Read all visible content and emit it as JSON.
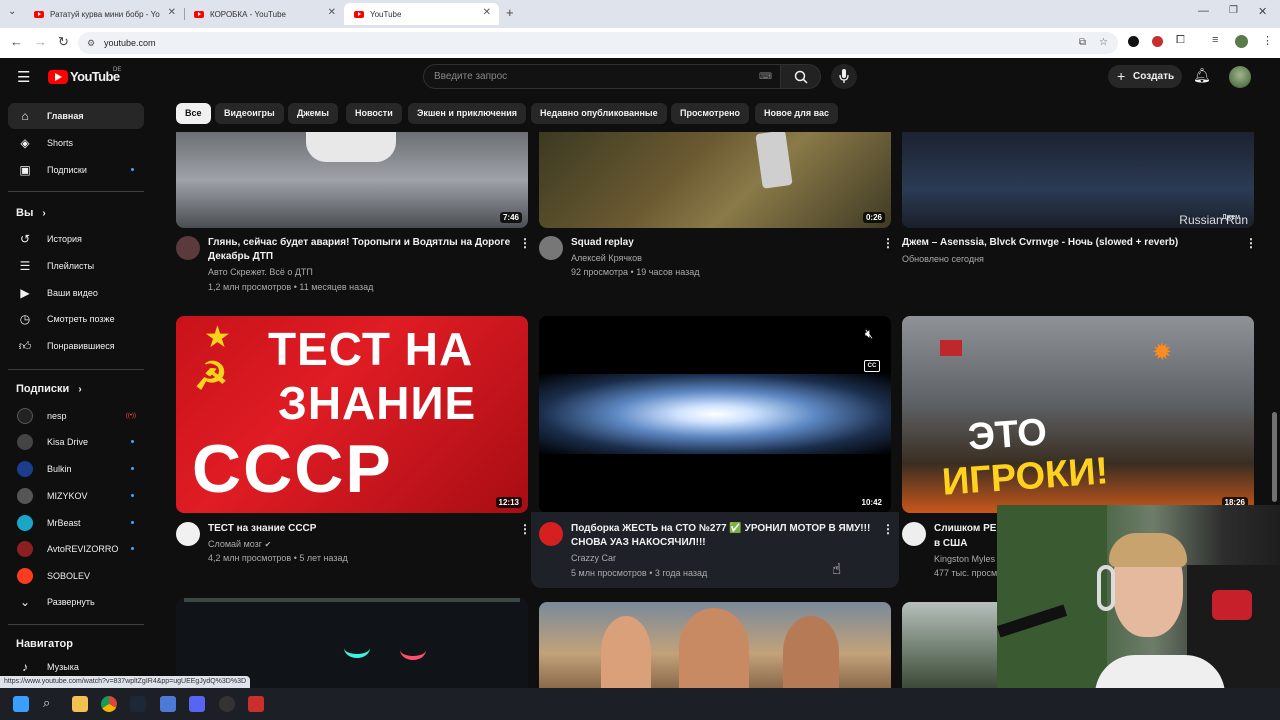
{
  "browser": {
    "tabs": [
      {
        "title": "Рататуй курва мини бобр - Yo"
      },
      {
        "title": "КОРОБКА - YouTube"
      },
      {
        "title": "YouTube"
      }
    ],
    "url": "youtube.com",
    "status_url": "https://www.youtube.com/watch?v=837wpltZgIR4&pp=ugUEEgJydQ%3D%3D"
  },
  "header": {
    "logo": "YouTube",
    "country": "DE",
    "search_placeholder": "Введите запрос",
    "create_label": "Создать"
  },
  "sidebar": {
    "main": [
      {
        "label": "Главная",
        "icon": "home-icon"
      },
      {
        "label": "Shorts",
        "icon": "shorts-icon"
      },
      {
        "label": "Подписки",
        "icon": "subscriptions-icon"
      }
    ],
    "you_heading": "Вы",
    "you": [
      {
        "label": "История",
        "icon": "history-icon"
      },
      {
        "label": "Плейлисты",
        "icon": "playlists-icon"
      },
      {
        "label": "Ваши видео",
        "icon": "your-videos-icon"
      },
      {
        "label": "Смотреть позже",
        "icon": "watch-later-icon"
      },
      {
        "label": "Понравившиеся",
        "icon": "liked-icon"
      }
    ],
    "subs_heading": "Подписки",
    "subs": [
      {
        "label": "nesp",
        "color": "#222222",
        "badge": "live"
      },
      {
        "label": "Kisa Drive",
        "color": "#444444"
      },
      {
        "label": "Bulkin",
        "color": "#1a3e8c"
      },
      {
        "label": "MIZYKOV",
        "color": "#555555"
      },
      {
        "label": "MrBeast",
        "color": "#1aa6c9"
      },
      {
        "label": "AvtoREVIZORRO",
        "color": "#8a2020"
      },
      {
        "label": "SOBOLEV",
        "color": "#ff3b1f"
      }
    ],
    "expand_label": "Развернуть",
    "navigator_heading": "Навигатор",
    "music_label": "Музыка"
  },
  "chips": [
    "Все",
    "Видеоигры",
    "Джемы",
    "Новости",
    "Экшен и приключения",
    "Недавно опубликованные",
    "Просмотрено",
    "Новое для вас"
  ],
  "videos_row1": [
    {
      "title": "Глянь, сейчас будет авария! Торопыги и Водятлы на Дороге Декабрь ДТП",
      "channel": "Авто Скрежет. Всё о ДТП",
      "views": "1,2 млн просмотров",
      "age": "11 месяцев назад",
      "duration": "7:46"
    },
    {
      "title": "Squad replay",
      "channel": "Алексей Крячков",
      "views": "92 просмотра",
      "age": "19 часов назад",
      "duration": "0:26"
    },
    {
      "title": "Джем – Asenssia, Blvck Cvrnvge - Ночь (slowed + reverb)",
      "channel": "Обновлено сегодня",
      "overlay_a": "Russian Run",
      "overlay_b": "Джем"
    }
  ],
  "videos_row2": [
    {
      "title": "ТЕСТ на знание СССР",
      "channel": "Сломай мозг",
      "views": "4,2 млн просмотров",
      "age": "5 лет назад",
      "duration": "12:13",
      "thumb_text": [
        "ТЕСТ НА",
        "ЗНАНИЕ",
        "СССР"
      ]
    },
    {
      "title": "Подборка ЖЕСТЬ на СТО №277 ✅ УРОНИЛ МОТОР В ЯМУ!!! СНОВА УАЗ НАКОСЯЧИЛ!!!",
      "channel": "Crazzy Car",
      "views": "5 млн просмотров",
      "age": "3 года назад",
      "duration": "10:42",
      "cc": "CC"
    },
    {
      "title": "Слишком РЕ",
      "title2": "в США",
      "channel": "Kingston Myles",
      "views": "477 тыс. просм",
      "duration": "18:26",
      "thumb_text": [
        "ЭТО",
        "ИГРОКИ!"
      ]
    }
  ]
}
